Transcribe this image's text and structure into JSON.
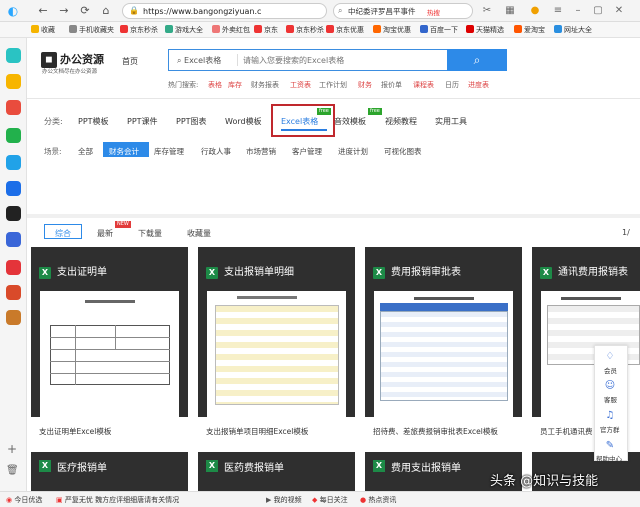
{
  "browser": {
    "url": "https://www.bangongziyuan.c",
    "search_text": "中纪委评罗昌平事件",
    "search_hot": "热搜",
    "bookmarks": [
      "收藏",
      "手机收藏夹",
      "京东秒杀",
      "游戏大全",
      "外卖红包",
      "京东",
      "京东秒杀",
      "京东优惠",
      "淘宝优惠",
      "百度一下",
      "天猫精选",
      "爱淘宝",
      "网址大全"
    ]
  },
  "site": {
    "logo_name": "办公资源",
    "logo_slogan": "办公文档尽在办公资源",
    "home": "首页",
    "search_category": "Excel表格",
    "search_placeholder": "请输入您要搜索的Excel表格",
    "hot_label": "热门搜索:",
    "hot_words": [
      "表格",
      "库存",
      "财务报表",
      "工资表",
      "工作计划",
      "财务",
      "报价单",
      "课程表",
      "日历",
      "进度表"
    ]
  },
  "categories": {
    "label": "分类:",
    "items": [
      "PPT模板",
      "PPT课件",
      "PPT图表",
      "Word模板",
      "Excel表格",
      "音效模板",
      "视频教程",
      "实用工具"
    ],
    "badges": [
      "free",
      "free"
    ]
  },
  "scenes": {
    "label": "场景:",
    "items": [
      "全部",
      "财务会计",
      "库存管理",
      "行政人事",
      "市场营销",
      "客户管理",
      "进度计划",
      "可视化图表"
    ]
  },
  "sort": {
    "items": [
      "综合",
      "最新",
      "下载量",
      "收藏量"
    ],
    "new_badge": "NEW",
    "page": "1/"
  },
  "cards": [
    {
      "title": "支出证明单",
      "caption": "支出证明单Excel模板"
    },
    {
      "title": "支出报销单明细",
      "caption": "支出报销单项目明细Excel模板"
    },
    {
      "title": "费用报销审批表",
      "caption": "招待费、差旅费报销审批表Excel模板"
    },
    {
      "title": "通讯费用报销表",
      "caption": "员工手机通讯费"
    }
  ],
  "cards_row2": [
    "医疗报销单",
    "医药费报销单",
    "费用支出报销单"
  ],
  "float_menu": [
    "会员",
    "客服",
    "官方群",
    "帮助中心"
  ],
  "watermark": "头条 @知识与技能",
  "statusbar": [
    "今日优选",
    "严复无忧 魏方应评细细唐请有关情况",
    "我的视频",
    "每日关注",
    "热点资讯"
  ]
}
